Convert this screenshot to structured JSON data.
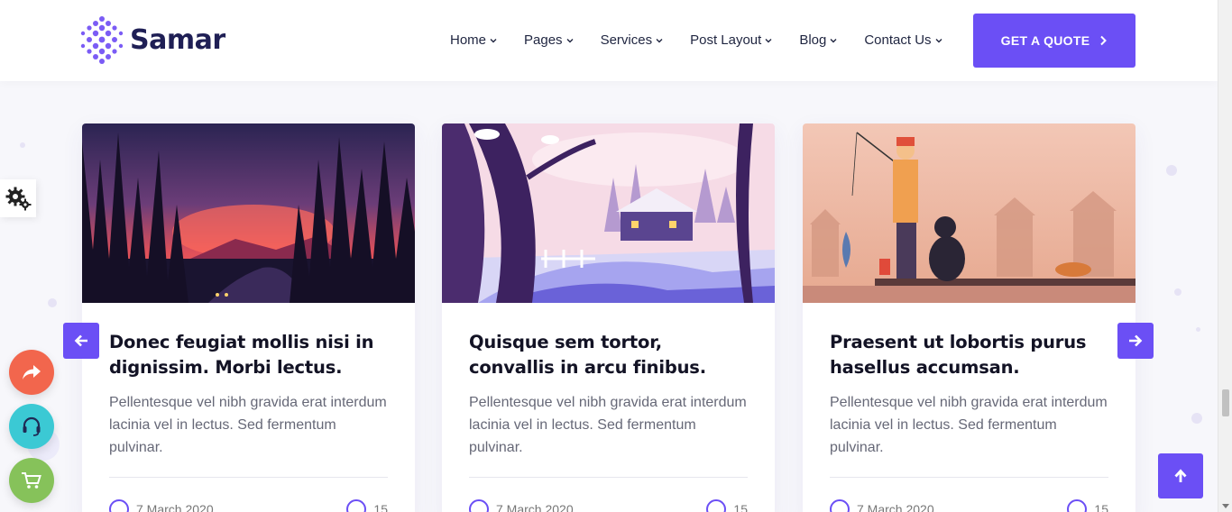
{
  "brand": {
    "name": "Samar"
  },
  "nav": {
    "items": [
      {
        "label": "Home"
      },
      {
        "label": "Pages"
      },
      {
        "label": "Services"
      },
      {
        "label": "Post Layout"
      },
      {
        "label": "Blog"
      },
      {
        "label": "Contact Us"
      }
    ],
    "cta_label": "GET A QUOTE"
  },
  "colors": {
    "accent": "#6b4ff5",
    "share": "#f2664d",
    "support": "#3bc9d4",
    "cart": "#86c25a",
    "heading": "#131325",
    "body_text": "#666877"
  },
  "posts": [
    {
      "title": "Donec feugiat mollis nisi in dignissim. Morbi lectus.",
      "excerpt": "Pellentesque vel nibh gravida erat interdum lacinia vel in lectus. Sed fermentum pulvinar.",
      "date": "7 March 2020",
      "comments": "15"
    },
    {
      "title": "Quisque sem tortor, convallis in arcu finibus.",
      "excerpt": "Pellentesque vel nibh gravida erat interdum lacinia vel in lectus. Sed fermentum pulvinar.",
      "date": "7 March 2020",
      "comments": "15"
    },
    {
      "title": "Praesent ut lobortis purus hasellus accumsan.",
      "excerpt": "Pellentesque vel nibh gravida erat interdum lacinia vel in lectus. Sed fermentum pulvinar.",
      "date": "7 March 2020",
      "comments": "15"
    }
  ],
  "icons": {
    "settings": "gears-icon",
    "share": "share-icon",
    "support": "headset-icon",
    "cart": "cart-icon",
    "prev": "arrow-left-icon",
    "next": "arrow-right-icon",
    "top": "arrow-up-icon"
  }
}
